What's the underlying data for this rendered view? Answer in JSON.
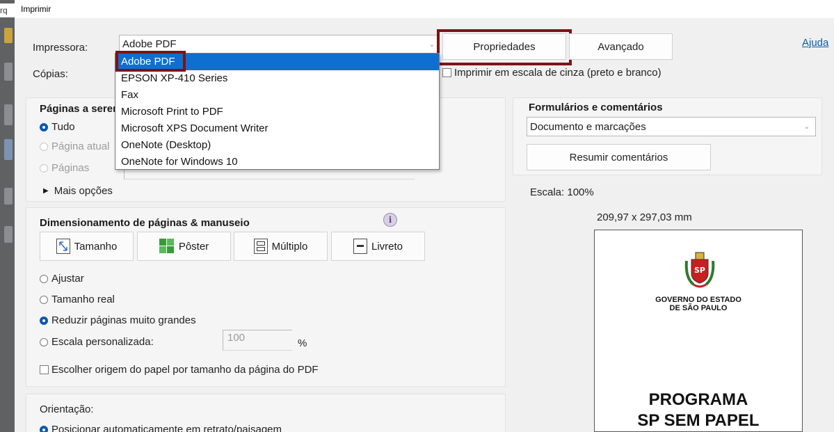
{
  "window": {
    "title": "Imprimir",
    "left_fragment": "rq"
  },
  "printer": {
    "label": "Impressora:",
    "selected": "Adobe PDF",
    "options": [
      "Adobe PDF",
      "EPSON XP-410 Series",
      "Fax",
      "Microsoft Print to PDF",
      "Microsoft XPS Document Writer",
      "OneNote (Desktop)",
      "OneNote for Windows 10"
    ]
  },
  "copies": {
    "label": "Cópias:"
  },
  "buttons": {
    "properties": "Propriedades",
    "advanced": "Avançado",
    "help": "Ajuda"
  },
  "grayscale": {
    "label": "Imprimir em escala de cinza (preto e branco)",
    "checked": false
  },
  "pages": {
    "heading": "Páginas a serem",
    "all": "Tudo",
    "current": "Página atual",
    "pages": "Páginas",
    "more": "Mais opções"
  },
  "forms": {
    "heading": "Formulários e comentários",
    "selected": "Documento e marcações",
    "summarize": "Resumir comentários"
  },
  "scale": {
    "label": "Escala: 100%"
  },
  "sizing": {
    "heading": "Dimensionamento de páginas & manuseio",
    "modes": [
      "Tamanho",
      "Pôster",
      "Múltiplo",
      "Livreto"
    ],
    "fit": "Ajustar",
    "actual": "Tamanho real",
    "shrink": "Reduzir páginas muito grandes",
    "custom": "Escala personalizada:",
    "custom_value": "100",
    "percent": "%",
    "paper_source": "Escolher origem do papel por tamanho da página do PDF"
  },
  "orientation": {
    "heading": "Orientação:",
    "auto": "Posicionar automaticamente em retrato/paisagem"
  },
  "preview": {
    "dimensions": "209,97 x 297,03 mm",
    "gov_line1": "GOVERNO DO ESTADO",
    "gov_line2": "DE SÃO PAULO",
    "program_line1": "PROGRAMA",
    "program_line2": "SP SEM PAPEL"
  },
  "colors": {
    "accent": "#0e6fd1",
    "highlight": "#7b1416",
    "link": "#0b5cad"
  }
}
